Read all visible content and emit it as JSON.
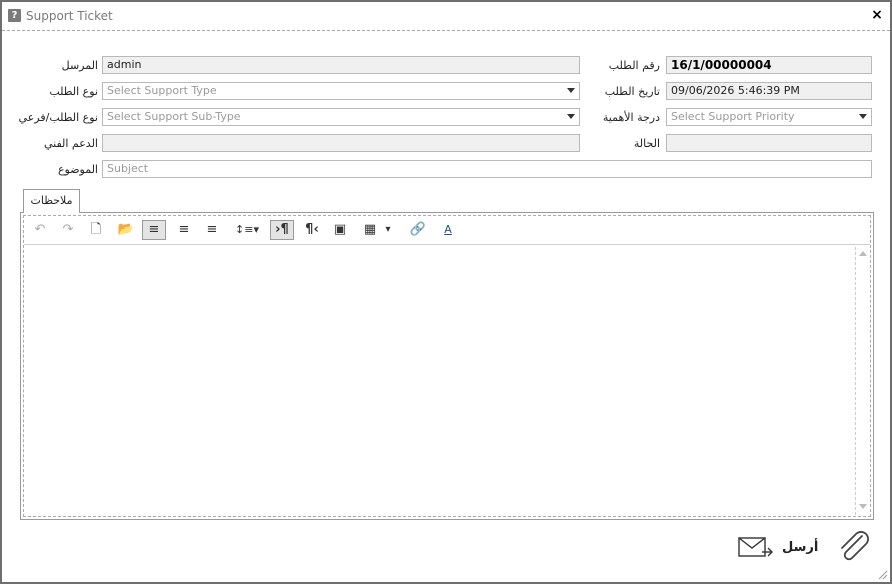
{
  "window": {
    "title": "Support Ticket",
    "title_icon": "?",
    "close_glyph": "×"
  },
  "form": {
    "sender": {
      "label": "المرسل",
      "value": "admin"
    },
    "request_type": {
      "label": "نوع الطلب",
      "placeholder": "Select Support Type"
    },
    "request_subtype": {
      "label": "نوع الطلب/فرعي",
      "placeholder": "Select Support Sub-Type"
    },
    "tech_support": {
      "label": "الدعم الفني",
      "value": ""
    },
    "subject": {
      "label": "الموضوع",
      "placeholder": "Subject"
    },
    "request_number": {
      "label": "رقم الطلب",
      "value": "16/1/00000004"
    },
    "request_date": {
      "label": "تاريخ الطلب",
      "value": "09/06/2026 5:46:39 PM"
    },
    "priority": {
      "label": "درجة الأهمية",
      "placeholder": "Select Support Priority"
    },
    "status": {
      "label": "الحالة",
      "value": ""
    }
  },
  "tabs": [
    {
      "label": "ملاحظات"
    }
  ],
  "toolbar": [
    {
      "name": "undo-icon",
      "glyph": "↶"
    },
    {
      "name": "redo-icon",
      "glyph": "↷"
    },
    {
      "name": "new-document-icon",
      "glyph": "🗋"
    },
    {
      "name": "open-folder-icon",
      "glyph": "📂"
    },
    {
      "name": "align-left-icon",
      "glyph": "≡"
    },
    {
      "name": "align-center-icon",
      "glyph": "≡"
    },
    {
      "name": "align-right-icon",
      "glyph": "≡"
    },
    {
      "name": "line-spacing-icon",
      "glyph": "↕≡▾"
    },
    {
      "name": "ltr-paragraph-icon",
      "glyph": "›¶"
    },
    {
      "name": "rtl-paragraph-icon",
      "glyph": "¶‹"
    },
    {
      "name": "insert-image-icon",
      "glyph": "▣"
    },
    {
      "name": "insert-table-icon",
      "glyph": "▦"
    },
    {
      "name": "table-dropdown-icon",
      "glyph": "▾"
    },
    {
      "name": "insert-link-icon",
      "glyph": "🔗"
    },
    {
      "name": "text-box-icon",
      "glyph": "A"
    }
  ],
  "actions": {
    "send_label": "أرسل"
  }
}
